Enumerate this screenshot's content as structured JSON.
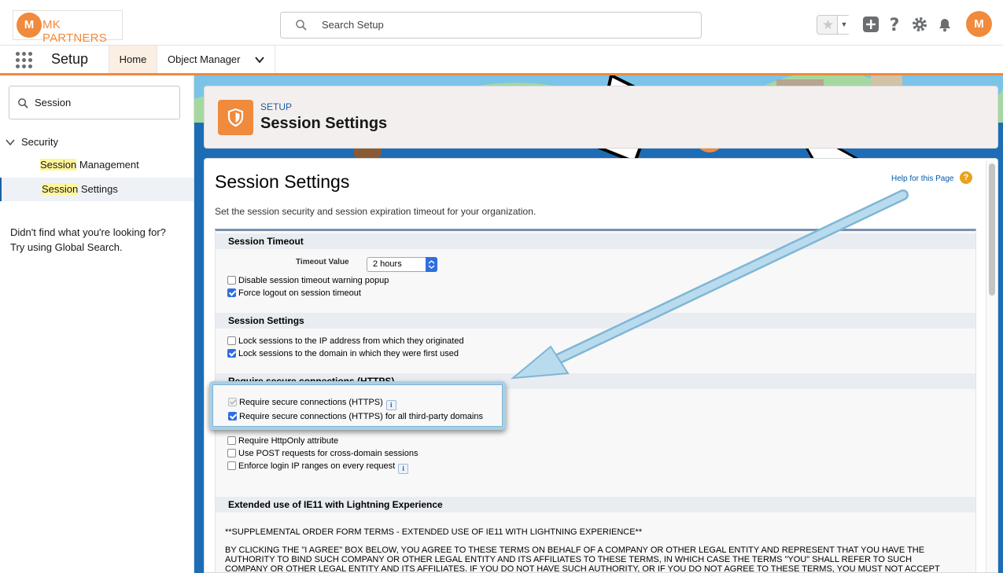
{
  "header": {
    "logo_mark": "M",
    "logo_text": "MK PARTNERS",
    "search_placeholder": "Search Setup",
    "avatar_initials": "M",
    "colors": {
      "brand_orange": "#f08a3c",
      "link_blue": "#015ba7",
      "check_blue": "#2f6ee0"
    }
  },
  "nav": {
    "app_name": "Setup",
    "tabs": [
      {
        "label": "Home",
        "active": true
      },
      {
        "label": "Object Manager",
        "active": false
      }
    ]
  },
  "sidebar": {
    "quick_find_value": "Session",
    "section": "Security",
    "items": [
      {
        "highlight": "Session",
        "rest": " Management",
        "active": false
      },
      {
        "highlight": "Session",
        "rest": " Settings",
        "active": true
      }
    ],
    "not_found_line1": "Didn't find what you're looking for?",
    "not_found_line2": "Try using Global Search."
  },
  "page_header": {
    "eyebrow": "SETUP",
    "title": "Session Settings",
    "icon": "shield-icon"
  },
  "main": {
    "title": "Session Settings",
    "help_link": "Help for this Page",
    "description": "Set the session security and session expiration timeout for your organization.",
    "sections": {
      "timeout": {
        "heading": "Session Timeout",
        "timeout_label": "Timeout Value",
        "timeout_value": "2 hours",
        "disable_warning": {
          "label": "Disable session timeout warning popup",
          "checked": false
        },
        "force_logout": {
          "label": "Force logout on session timeout",
          "checked": true
        }
      },
      "session": {
        "heading": "Session Settings",
        "lock_ip": {
          "label": "Lock sessions to the IP address from which they originated",
          "checked": false
        },
        "lock_domain": {
          "label": "Lock sessions to the domain in which they were first used",
          "checked": true
        }
      },
      "https": {
        "heading": "Require secure connections (HTTPS)",
        "require_https": {
          "label": "Require secure connections (HTTPS)",
          "checked": true,
          "disabled": true
        },
        "require_https_third_party": {
          "label": "Require secure connections (HTTPS) for all third-party domains",
          "checked": true
        },
        "httponly": {
          "label": "Require HttpOnly attribute",
          "checked": false
        },
        "post_requests": {
          "label": "Use POST requests for cross-domain sessions",
          "checked": false
        },
        "enforce_ip": {
          "label": "Enforce login IP ranges on every request",
          "checked": false
        }
      },
      "ie11": {
        "heading": "Extended use of IE11 with Lightning Experience",
        "terms_title": "**SUPPLEMENTAL ORDER FORM TERMS - EXTENDED USE OF IE11 WITH LIGHTNING EXPERIENCE**",
        "terms_line1": "BY CLICKING THE \"I AGREE\" BOX BELOW, YOU AGREE TO THESE TERMS ON BEHALF OF A COMPANY OR OTHER LEGAL ENTITY AND REPRESENT THAT YOU HAVE THE",
        "terms_line2": "AUTHORITY TO BIND SUCH COMPANY OR OTHER LEGAL ENTITY AND ITS AFFILIATES TO THESE TERMS, IN WHICH CASE THE TERMS \"YOU\" SHALL REFER TO SUCH",
        "terms_line3": "COMPANY OR OTHER LEGAL ENTITY AND ITS AFFILIATES. IF YOU DO NOT HAVE SUCH AUTHORITY, OR IF YOU DO NOT AGREE TO THESE TERMS, YOU MUST NOT ACCEPT"
      }
    }
  },
  "info_icon_glyph": "i"
}
